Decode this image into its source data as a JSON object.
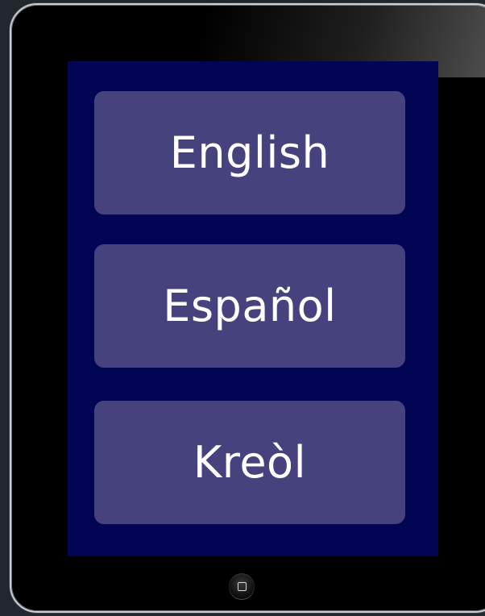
{
  "device": {
    "frame_color": "#000000",
    "screen_color": "#020454",
    "button_color": "#46427e"
  },
  "languages": [
    {
      "label": "English"
    },
    {
      "label": "Español"
    },
    {
      "label": "Kreòl"
    }
  ],
  "icons": {
    "home": "home-button-icon"
  }
}
